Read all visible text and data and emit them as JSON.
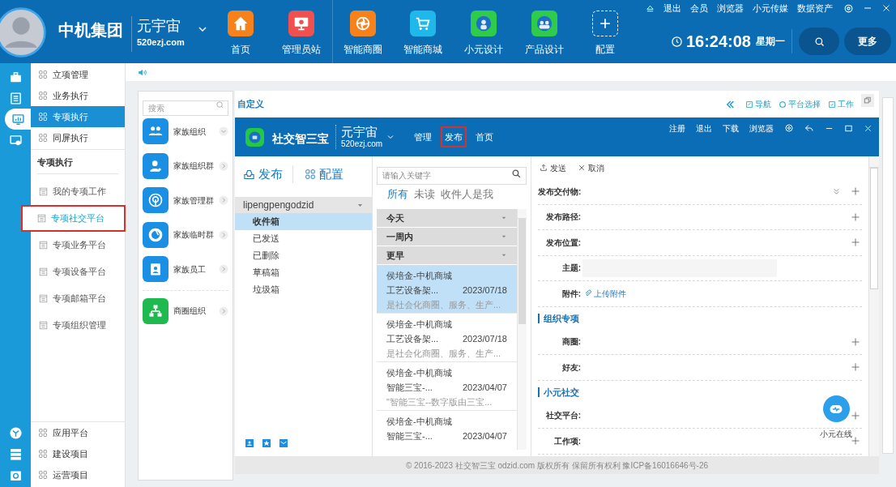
{
  "topbar": {
    "brand": "中机集团",
    "site_title": "元宇宙",
    "site_domain": "520ezj.com",
    "apps": [
      {
        "label": "首页",
        "kind": "home",
        "color": "#f7821b"
      },
      {
        "label": "管理员站",
        "kind": "monitor",
        "color": "#f0514f"
      },
      {
        "label": "智能商圈",
        "kind": "aperture",
        "color": "#f7821b"
      },
      {
        "label": "智能商城",
        "kind": "cart",
        "color": "#1fb8ea"
      },
      {
        "label": "小元设计",
        "kind": "robot",
        "color": "#2ecc4a"
      },
      {
        "label": "产品设计",
        "kind": "robots",
        "color": "#2ecc4a"
      },
      {
        "label": "配置",
        "kind": "add"
      }
    ],
    "links": [
      "退出",
      "会员",
      "浏览器",
      "小元传媒",
      "数据资产"
    ],
    "time": "16:24:08",
    "weekday": "星期一",
    "more": "更多"
  },
  "rail": {
    "top": [
      {
        "kind": "briefcase",
        "selected": false
      },
      {
        "kind": "list",
        "selected": false
      },
      {
        "kind": "chart",
        "selected": true
      },
      {
        "kind": "screen",
        "selected": false
      }
    ],
    "bottom": [
      {
        "kind": "cube"
      },
      {
        "kind": "server"
      },
      {
        "kind": "gear"
      }
    ]
  },
  "menu": {
    "top_items": [
      {
        "label": "立项管理",
        "selected": false
      },
      {
        "label": "业务执行",
        "selected": false
      },
      {
        "label": "专项执行",
        "selected": true
      },
      {
        "label": "同屏执行",
        "selected": false
      }
    ],
    "section_title": "专项执行",
    "section_items": [
      {
        "label": "我的专项工作",
        "selected": false,
        "outlined": false
      },
      {
        "label": "专项社交平台",
        "selected": true,
        "outlined": true
      },
      {
        "label": "专项业务平台",
        "selected": false,
        "outlined": false
      },
      {
        "label": "专项设备平台",
        "selected": false,
        "outlined": false
      },
      {
        "label": "专项邮箱平台",
        "selected": false,
        "outlined": false
      },
      {
        "label": "专项组织管理",
        "selected": false,
        "outlined": false
      }
    ],
    "bottom_items": [
      {
        "label": "应用平台",
        "selected": false
      },
      {
        "label": "建设项目",
        "selected": false
      },
      {
        "label": "运营项目",
        "selected": false
      }
    ]
  },
  "org_panel": {
    "search_placeholder": "搜索",
    "groups": [
      {
        "items": [
          {
            "label": "家族组织",
            "kind": "people",
            "color": "#1a8fe3",
            "expanded": true
          },
          {
            "label": "家族组织群",
            "kind": "person",
            "color": "#1a8fe3",
            "expanded": false
          },
          {
            "label": "家族管理群",
            "kind": "signal",
            "color": "#1a8fe3",
            "expanded": false
          },
          {
            "label": "家族临时群",
            "kind": "aperture",
            "color": "#1a8fe3",
            "expanded": false
          },
          {
            "label": "家族员工",
            "kind": "badge",
            "color": "#1a8fe3",
            "expanded": false
          }
        ]
      },
      {
        "items": [
          {
            "label": "商圈组织",
            "kind": "org",
            "color": "#1fba4f",
            "expanded": false
          }
        ]
      }
    ]
  },
  "workspace": {
    "title": "自定义",
    "links": [
      "导航",
      "平台选择",
      "工作"
    ],
    "app_header": {
      "logo_text": "社交智三宝",
      "site_title": "元宇宙",
      "site_domain": "520ezj.com",
      "nav": [
        {
          "label": "管理",
          "selected": false
        },
        {
          "label": "发布",
          "selected": true
        },
        {
          "label": "首页",
          "selected": false
        }
      ],
      "links": [
        "注册",
        "退出",
        "下载",
        "浏览器"
      ]
    },
    "mailbox": {
      "actions": [
        {
          "label": "发布",
          "kind": "publish"
        },
        {
          "label": "配置",
          "kind": "config"
        }
      ],
      "account": "lipengpengodzid",
      "folders": [
        {
          "label": "收件箱",
          "selected": true
        },
        {
          "label": "已发送",
          "selected": false
        },
        {
          "label": "已删除",
          "selected": false
        },
        {
          "label": "草稿箱",
          "selected": false
        },
        {
          "label": "垃圾箱",
          "selected": false
        }
      ]
    },
    "message_list": {
      "search_placeholder": "请输入关键字",
      "filters": [
        {
          "label": "所有",
          "selected": true
        },
        {
          "label": "未读",
          "selected": false
        },
        {
          "label": "收件人是我",
          "selected": false
        }
      ],
      "groups": [
        "今天",
        "一周内",
        "更早"
      ],
      "messages": [
        {
          "sender": "侯培金-中机商城",
          "subject": "工艺设备架...",
          "date": "2023/07/18",
          "preview": "是社会化商圈、服务、生产...",
          "selected": true
        },
        {
          "sender": "侯培金-中机商城",
          "subject": "工艺设备架...",
          "date": "2023/07/18",
          "preview": "是社会化商圈、服务、生产...",
          "selected": false
        },
        {
          "sender": "侯培金-中机商城",
          "subject": "智能三宝-...",
          "date": "2023/04/07",
          "preview": "\"智能三宝--数字版由三宝...",
          "selected": false
        },
        {
          "sender": "侯培金-中机商城",
          "subject": "智能三宝-...",
          "date": "2023/04/07",
          "selected": false
        }
      ]
    },
    "compose": {
      "actions": [
        {
          "label": "发送",
          "kind": "send"
        },
        {
          "label": "取消",
          "kind": "cancel"
        }
      ],
      "rows": [
        {
          "kind": "expand_add",
          "label": "发布交付物:"
        },
        {
          "kind": "add",
          "label": "发布路径:"
        },
        {
          "kind": "add",
          "label": "发布位置:"
        },
        {
          "kind": "input",
          "label": "主题:"
        },
        {
          "kind": "attach",
          "label": "附件:",
          "link": "上传附件"
        },
        {
          "kind": "section",
          "label": "组织专项"
        },
        {
          "kind": "add",
          "label": "商圈:"
        },
        {
          "kind": "add",
          "label": "好友:"
        },
        {
          "kind": "section",
          "label": "小元社交"
        },
        {
          "kind": "add",
          "label": "社交平台:"
        },
        {
          "kind": "add",
          "label": "工作项:"
        }
      ]
    },
    "chat_widget": {
      "label": "小元在线"
    },
    "footer": "© 2016-2023 社交智三宝 odzid.com 版权所有 保留所有权利 豫ICP备16016646号-26"
  }
}
